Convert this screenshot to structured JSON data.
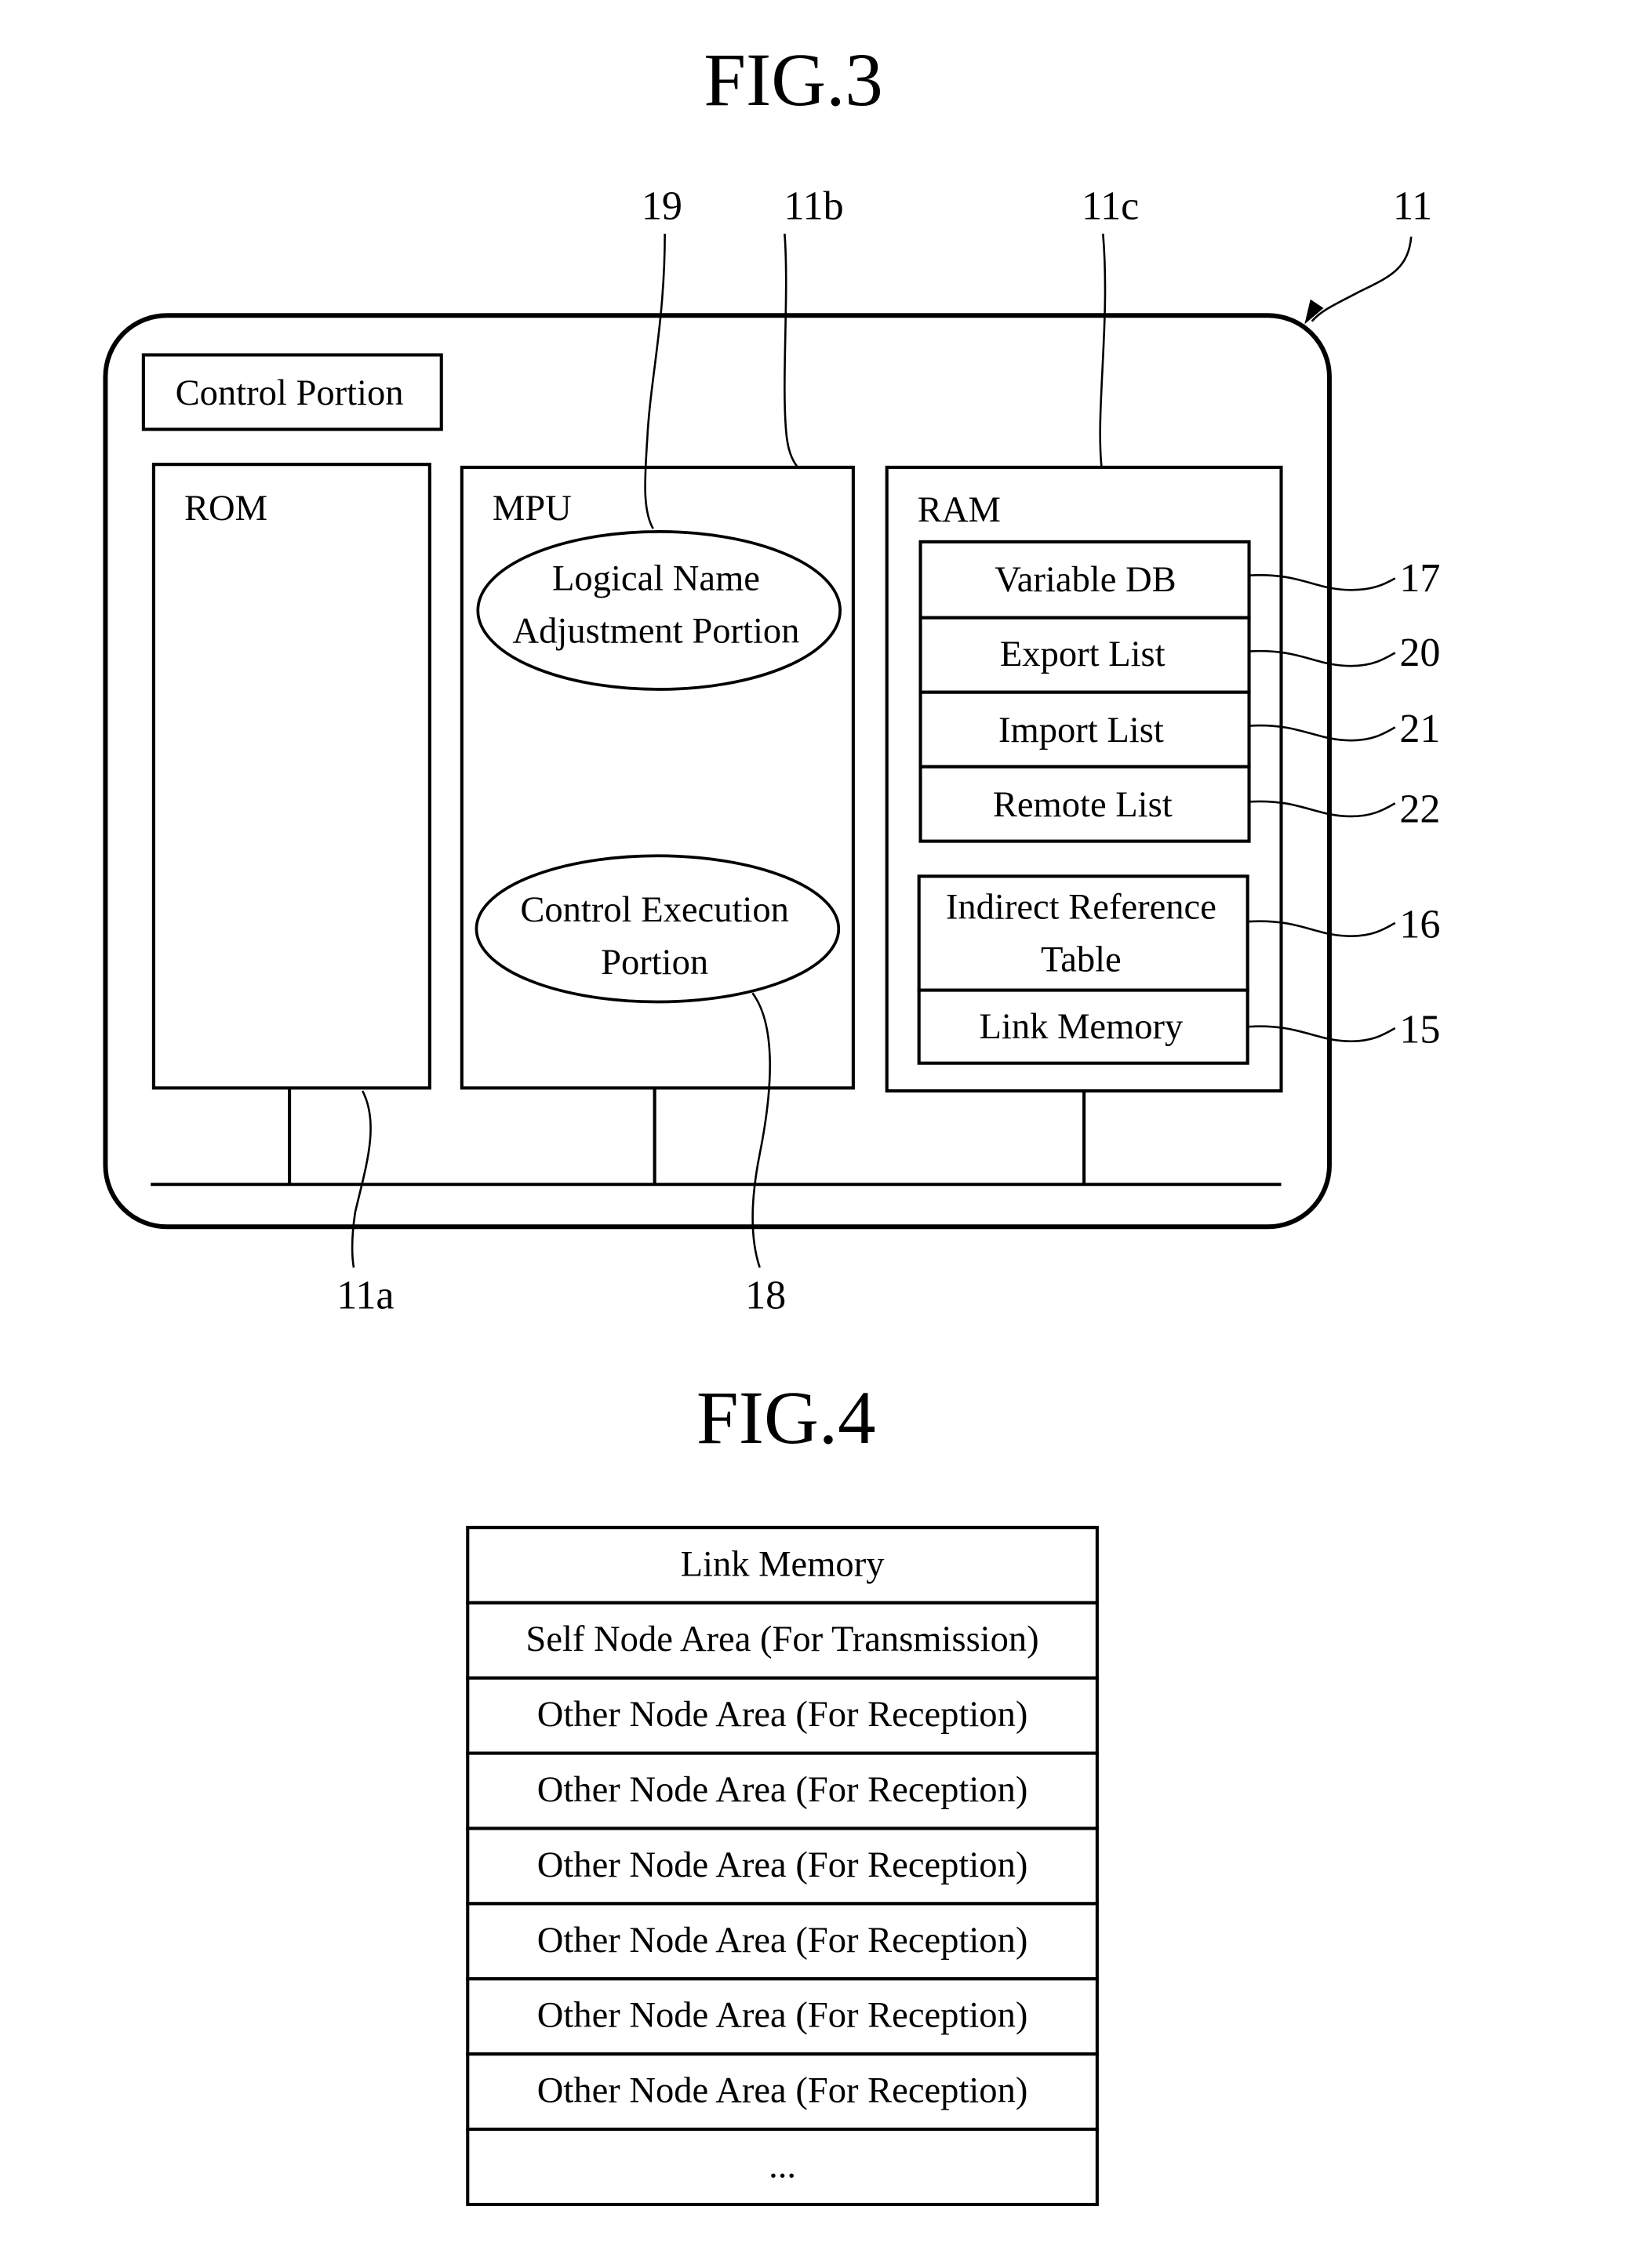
{
  "fig3": {
    "title": "FIG.3",
    "refs": {
      "r19": "19",
      "r11b": "11b",
      "r11c": "11c",
      "r11": "11",
      "r11a": "11a",
      "r18": "18",
      "r17": "17",
      "r20": "20",
      "r21": "21",
      "r22": "22",
      "r16": "16",
      "r15": "15"
    },
    "control_portion": "Control Portion",
    "rom": "ROM",
    "mpu": {
      "label": "MPU",
      "logical_name_line1": "Logical Name",
      "logical_name_line2": "Adjustment Portion",
      "control_exec_line1": "Control Execution",
      "control_exec_line2": "Portion"
    },
    "ram": {
      "label": "RAM",
      "items": [
        "Variable DB",
        "Export List",
        "Import List",
        "Remote List"
      ],
      "indirect_line1": "Indirect Reference",
      "indirect_line2": "Table",
      "link_memory": "Link Memory"
    }
  },
  "fig4": {
    "title": "FIG.4",
    "rows": [
      "Link Memory",
      "Self Node Area (For Transmission)",
      "Other Node Area (For Reception)",
      "Other Node Area (For Reception)",
      "Other Node Area (For Reception)",
      "Other Node Area (For Reception)",
      "Other Node Area (For Reception)",
      "Other Node Area (For Reception)",
      "..."
    ]
  }
}
